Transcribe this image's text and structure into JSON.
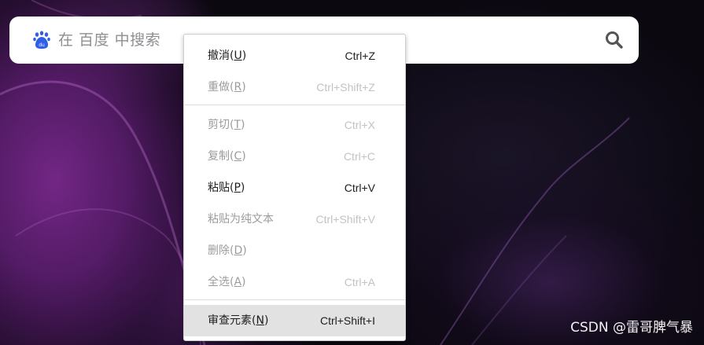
{
  "search": {
    "placeholder": "在 百度 中搜索",
    "logo_icon": "baidu-paw-icon",
    "search_icon": "magnifier-icon",
    "brand_color": "#2f5ee8"
  },
  "context_menu": {
    "items": [
      {
        "label": "撤消(U)",
        "label_main": "撤消(",
        "mnemonic": "U",
        "label_end": ")",
        "shortcut": "Ctrl+Z",
        "enabled": true
      },
      {
        "label": "重做(R)",
        "label_main": "重做(",
        "mnemonic": "R",
        "label_end": ")",
        "shortcut": "Ctrl+Shift+Z",
        "enabled": false
      },
      {
        "label": "剪切(T)",
        "label_main": "剪切(",
        "mnemonic": "T",
        "label_end": ")",
        "shortcut": "Ctrl+X",
        "enabled": false
      },
      {
        "label": "复制(C)",
        "label_main": "复制(",
        "mnemonic": "C",
        "label_end": ")",
        "shortcut": "Ctrl+C",
        "enabled": false
      },
      {
        "label": "粘贴(P)",
        "label_main": "粘贴(",
        "mnemonic": "P",
        "label_end": ")",
        "shortcut": "Ctrl+V",
        "enabled": true
      },
      {
        "label": "粘贴为纯文本",
        "label_main": "粘贴为纯文本",
        "mnemonic": "",
        "label_end": "",
        "shortcut": "Ctrl+Shift+V",
        "enabled": false
      },
      {
        "label": "删除(D)",
        "label_main": "删除(",
        "mnemonic": "D",
        "label_end": ")",
        "shortcut": "",
        "enabled": false
      },
      {
        "label": "全选(A)",
        "label_main": "全选(",
        "mnemonic": "A",
        "label_end": ")",
        "shortcut": "Ctrl+A",
        "enabled": false
      },
      {
        "label": "审查元素(N)",
        "label_main": "审查元素(",
        "mnemonic": "N",
        "label_end": ")",
        "shortcut": "Ctrl+Shift+I",
        "enabled": true,
        "highlighted": true
      }
    ]
  },
  "watermark": {
    "text": "CSDN @雷哥脾气暴"
  }
}
